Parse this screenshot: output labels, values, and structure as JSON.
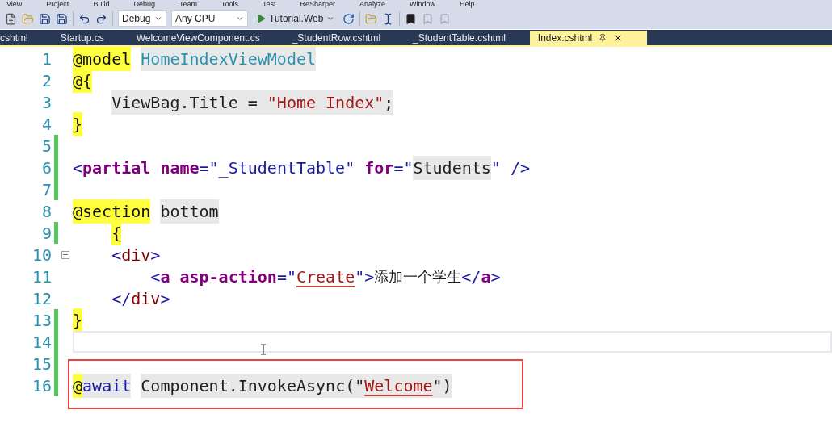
{
  "menu_bar": [
    "View",
    "Project",
    "Build",
    "Debug",
    "Team",
    "Tools",
    "Test",
    "ReSharper",
    "Analyze",
    "Window",
    "Help"
  ],
  "toolbar": {
    "configuration": "Debug",
    "platform": "Any CPU",
    "start_target": "Tutorial.Web"
  },
  "tabs": [
    {
      "label": "cshtml",
      "selected": false
    },
    {
      "label": "Startup.cs",
      "selected": false
    },
    {
      "label": "WelcomeViewComponent.cs",
      "selected": false
    },
    {
      "label": "_StudentRow.cshtml",
      "selected": false
    },
    {
      "label": "_StudentTable.cshtml",
      "selected": false
    },
    {
      "label": "Index.cshtml",
      "selected": true
    }
  ],
  "editor": {
    "lines": [
      {
        "number": "1",
        "changed": false,
        "collapsible": false,
        "current": false,
        "boxed": false,
        "tokens": [
          {
            "t": "@model",
            "kind": "razor"
          },
          {
            "t": " HomeIndexViewModel",
            "kind": "type",
            "shaded": true
          }
        ]
      },
      {
        "number": "2",
        "changed": false,
        "collapsible": false,
        "current": false,
        "boxed": false,
        "tokens": [
          {
            "t": "@{",
            "kind": "razor"
          }
        ]
      },
      {
        "number": "3",
        "changed": false,
        "collapsible": false,
        "current": false,
        "boxed": false,
        "tokens": [
          {
            "t": "    ViewBag.Title = ",
            "kind": "plain",
            "shaded": true
          },
          {
            "t": "\"Home Index\"",
            "kind": "string",
            "shaded": true
          },
          {
            "t": ";",
            "kind": "plain",
            "shaded": true
          }
        ]
      },
      {
        "number": "4",
        "changed": false,
        "collapsible": false,
        "current": false,
        "boxed": false,
        "tokens": [
          {
            "t": "}",
            "kind": "razor"
          }
        ]
      },
      {
        "number": "5",
        "changed": true,
        "collapsible": false,
        "current": false,
        "boxed": false
      },
      {
        "number": "6",
        "changed": true,
        "collapsible": false,
        "current": false,
        "boxed": false,
        "tokens": [
          {
            "t": "<",
            "kind": "delim"
          },
          {
            "t": "partial name",
            "kind": "element"
          },
          {
            "t": "=\"_StudentTable\" ",
            "kind": "delim"
          },
          {
            "t": "for",
            "kind": "element"
          },
          {
            "t": "=\"",
            "kind": "delim"
          },
          {
            "t": "Students",
            "kind": "plain",
            "shaded": true
          },
          {
            "t": "\" />",
            "kind": "delim"
          }
        ]
      },
      {
        "number": "7",
        "changed": true,
        "collapsible": false,
        "current": false,
        "boxed": false
      },
      {
        "number": "8",
        "changed": false,
        "collapsible": false,
        "current": false,
        "boxed": false,
        "tokens": [
          {
            "t": "@section",
            "kind": "razor"
          },
          {
            "t": " bottom",
            "kind": "plain",
            "shaded": true
          }
        ]
      },
      {
        "number": "9",
        "changed": true,
        "collapsible": false,
        "current": false,
        "boxed": false,
        "tokens": [
          {
            "t": "    {",
            "kind": "razor"
          }
        ]
      },
      {
        "number": "10",
        "changed": false,
        "collapsible": true,
        "current": false,
        "boxed": false,
        "tokens": [
          {
            "t": "    <",
            "kind": "delim"
          },
          {
            "t": "div",
            "kind": "tag"
          },
          {
            "t": ">",
            "kind": "delim"
          }
        ]
      },
      {
        "number": "11",
        "changed": false,
        "collapsible": false,
        "current": false,
        "boxed": false,
        "tokens": [
          {
            "t": "        <",
            "kind": "delim"
          },
          {
            "t": "a asp-action",
            "kind": "element"
          },
          {
            "t": "=\"",
            "kind": "delim"
          },
          {
            "t": "Create",
            "kind": "string",
            "underlined": true
          },
          {
            "t": "\">",
            "kind": "delim"
          },
          {
            "t": "添加一个学生",
            "kind": "cjk"
          },
          {
            "t": "</",
            "kind": "delim"
          },
          {
            "t": "a",
            "kind": "element"
          },
          {
            "t": ">",
            "kind": "delim"
          }
        ]
      },
      {
        "number": "12",
        "changed": false,
        "collapsible": false,
        "current": false,
        "boxed": false,
        "tokens": [
          {
            "t": "    </",
            "kind": "delim"
          },
          {
            "t": "div",
            "kind": "tag"
          },
          {
            "t": ">",
            "kind": "delim"
          }
        ]
      },
      {
        "number": "13",
        "changed": true,
        "collapsible": false,
        "current": false,
        "boxed": false,
        "tokens": [
          {
            "t": "}",
            "kind": "razor"
          }
        ]
      },
      {
        "number": "14",
        "changed": true,
        "collapsible": false,
        "current": true,
        "boxed": false
      },
      {
        "number": "15",
        "changed": true,
        "collapsible": false,
        "current": false,
        "boxed": true
      },
      {
        "number": "16",
        "changed": true,
        "collapsible": false,
        "current": false,
        "boxed": true,
        "tokens": [
          {
            "t": "@",
            "kind": "razor"
          },
          {
            "t": "await",
            "kind": "await",
            "shaded": true
          },
          {
            "t": " Component.InvokeAsync(\"",
            "kind": "plain",
            "shaded": true
          },
          {
            "t": "Welcome",
            "kind": "string",
            "shaded": true,
            "underlined": true
          },
          {
            "t": "\")",
            "kind": "plain",
            "shaded": true
          }
        ]
      }
    ]
  }
}
